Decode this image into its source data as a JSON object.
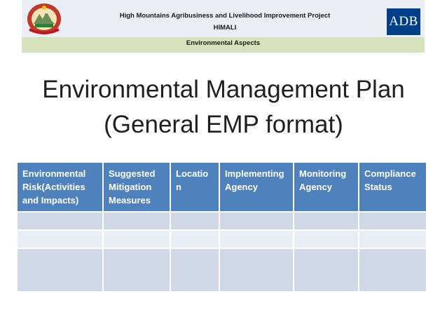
{
  "header": {
    "project_line1": "High Mountains Agribusiness and Livelihood Improvement Project",
    "project_line2": "HIMALI",
    "section_label": "Environmental Aspects",
    "adb_logo_text": "ADB",
    "emblem_icon": "nepal-government-emblem-icon"
  },
  "slide": {
    "title_line1": "Environmental Management Plan",
    "title_line2": "(General EMP format)"
  },
  "table": {
    "columns": [
      "Environmental Risk(Activities and Impacts)",
      "Suggested Mitigation Measures",
      "Location",
      "Implementing Agency",
      "Monitoring Agency",
      "Compliance Status"
    ],
    "rows": [
      [
        "",
        "",
        "",
        "",
        "",
        ""
      ],
      [
        "",
        "",
        "",
        "",
        "",
        ""
      ],
      [
        "",
        "",
        "",
        "",
        "",
        ""
      ]
    ]
  },
  "colors": {
    "header_bg": "#eceef6",
    "band_bg": "#d7e2bd",
    "table_header": "#4f81bd",
    "row_dark": "#d0d8e8",
    "row_light": "#e9edf4",
    "adb_blue": "#003f87"
  }
}
